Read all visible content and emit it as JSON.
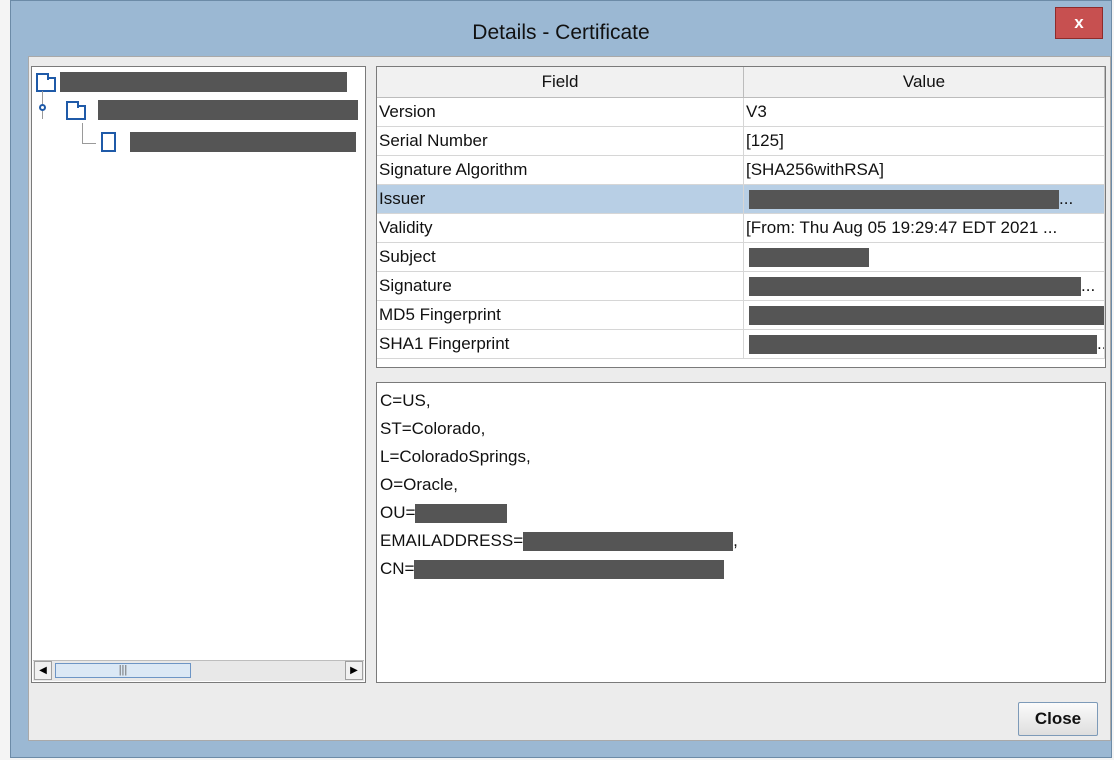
{
  "window": {
    "title": "Details - Certificate",
    "close_glyph": "x"
  },
  "table": {
    "headers": [
      "Field",
      "Value"
    ],
    "rows": [
      {
        "field": "Version",
        "value": "V3"
      },
      {
        "field": "Serial Number",
        "value": "[125]"
      },
      {
        "field": "Signature Algorithm",
        "value": "[SHA256withRSA]"
      },
      {
        "field": "Issuer",
        "value": "...",
        "redacted": true,
        "selected": true
      },
      {
        "field": "Validity",
        "value": "[From: Thu Aug 05 19:29:47 EDT 2021 ..."
      },
      {
        "field": "Subject",
        "value": "",
        "redacted": true
      },
      {
        "field": "Signature",
        "value": "...",
        "redacted": true
      },
      {
        "field": "MD5 Fingerprint",
        "value": ".",
        "redacted": true
      },
      {
        "field": "SHA1 Fingerprint",
        "value": "..",
        "redacted": true
      }
    ]
  },
  "detail": {
    "lines": [
      {
        "text": "C=US,"
      },
      {
        "text": "ST=Colorado,"
      },
      {
        "text": "L=ColoradoSprings,"
      },
      {
        "text": "O=Oracle,"
      },
      {
        "text": "OU=",
        "redacted": true
      },
      {
        "text": "EMAILADDRESS=",
        "redacted": true,
        "suffix": ","
      },
      {
        "text": "CN=",
        "redacted": true
      }
    ]
  },
  "buttons": {
    "close_label": "Close"
  },
  "scrollbar": {
    "thumb_glyph": "|||",
    "left_glyph": "◀",
    "right_glyph": "▶"
  }
}
